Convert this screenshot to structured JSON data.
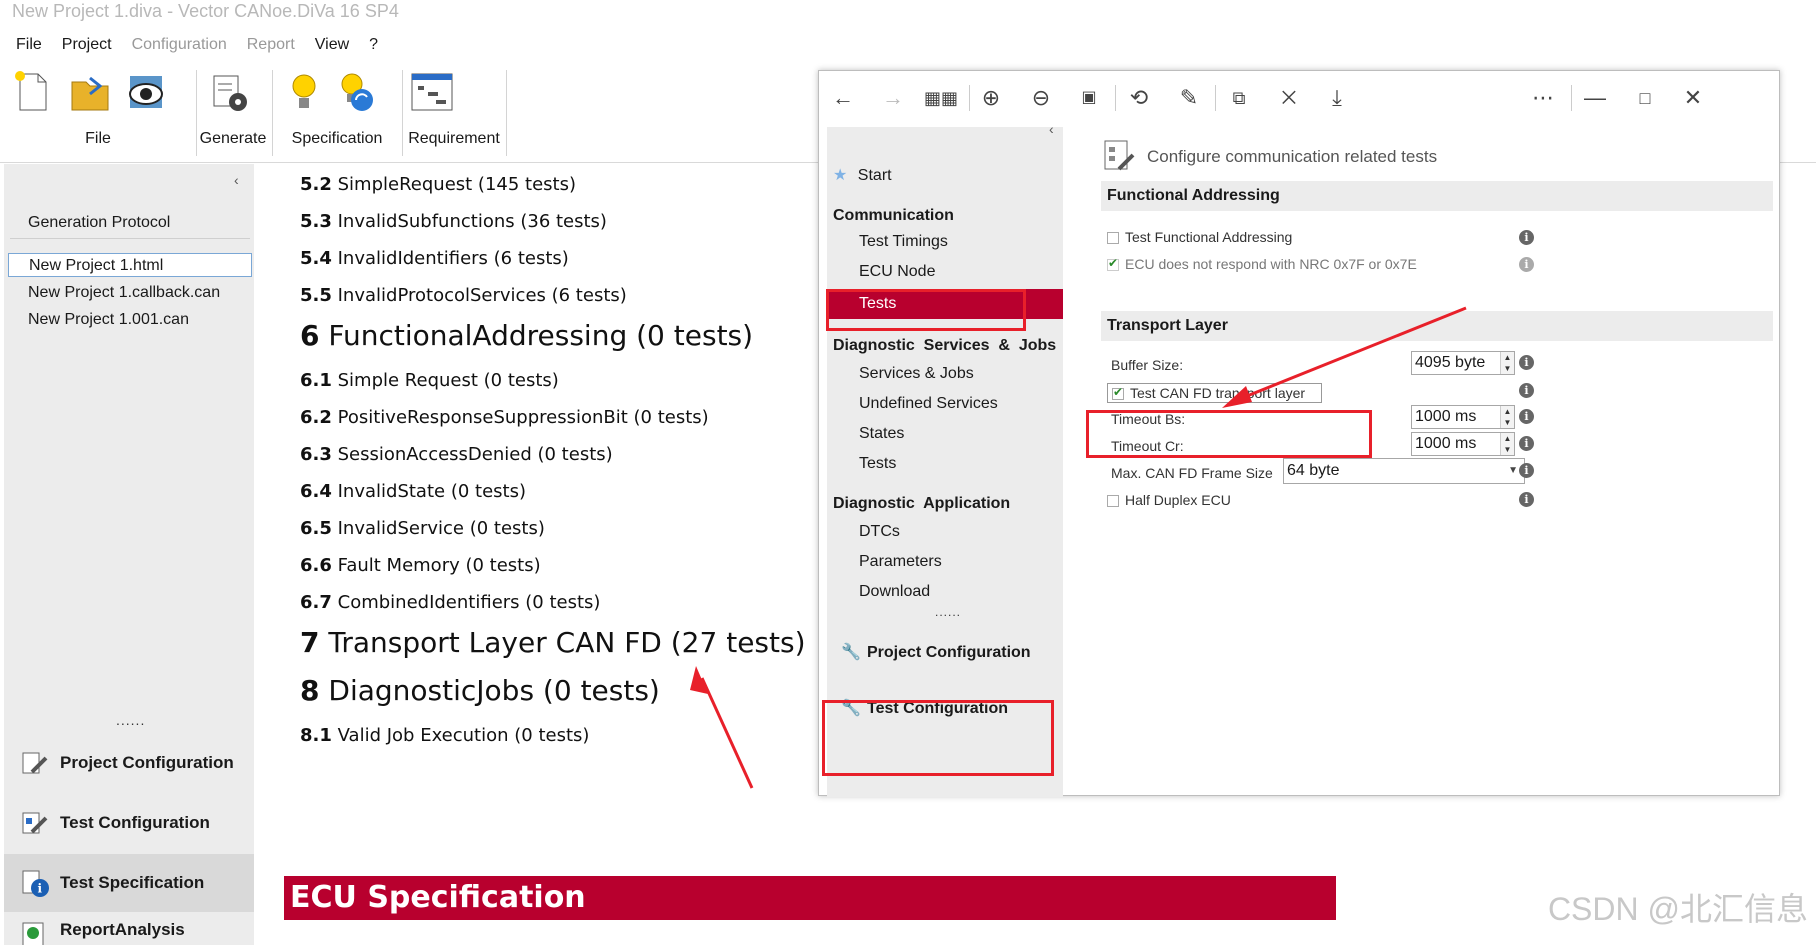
{
  "window_title": "New Project 1.diva - Vector CANoe.DiVa 16 SP4",
  "menu": [
    "File",
    "Project",
    "Configuration",
    "Report",
    "View",
    "?"
  ],
  "ribbon": {
    "file": "File",
    "generate": "Generate",
    "specification": "Specification",
    "requirement": "Requirement"
  },
  "left_panel": {
    "collapse": "‹",
    "heading": "Generation Protocol",
    "files": [
      "New Project 1.html",
      "New Project 1.callback.can",
      "New Project 1.001.can"
    ],
    "more": "......",
    "nav": [
      "Project Configuration",
      "Test Configuration",
      "Test Specification",
      "ReportAnalysis"
    ]
  },
  "tests_list": [
    {
      "num": "5.2",
      "text": "SimpleRequest (145 tests)"
    },
    {
      "num": "5.3",
      "text": "InvalidSubfunctions (36 tests)"
    },
    {
      "num": "5.4",
      "text": "InvalidIdentifiers (6 tests)"
    },
    {
      "num": "5.5",
      "text": "InvalidProtocolServices (6 tests)"
    },
    {
      "num": "6",
      "text": "FunctionalAddressing (0 tests)"
    },
    {
      "num": "6.1",
      "text": "Simple Request (0 tests)"
    },
    {
      "num": "6.2",
      "text": "PositiveResponseSuppressionBit (0 tests)"
    },
    {
      "num": "6.3",
      "text": "SessionAccessDenied (0 tests)"
    },
    {
      "num": "6.4",
      "text": "InvalidState (0 tests)"
    },
    {
      "num": "6.5",
      "text": "InvalidService (0 tests)"
    },
    {
      "num": "6.6",
      "text": "Fault Memory (0 tests)"
    },
    {
      "num": "6.7",
      "text": "CombinedIdentifiers (0 tests)"
    },
    {
      "num": "7",
      "text": "Transport Layer CAN FD (27 tests)"
    },
    {
      "num": "8",
      "text": "DiagnosticJobs (0 tests)"
    },
    {
      "num": "8.1",
      "text": "Valid Job Execution (0 tests)"
    }
  ],
  "ecu_spec": "ECU Specification",
  "dialog": {
    "collapse": "‹",
    "nav": {
      "start": "Start",
      "communication": "Communication",
      "test_timings": "Test Timings",
      "ecu_node": "ECU Node",
      "tests": "Tests",
      "diag_services_jobs": "Diagnostic  Services  &  Jobs",
      "services_jobs": "Services & Jobs",
      "undefined_services": "Undefined Services",
      "states": "States",
      "tests2": "Tests",
      "diag_application": "Diagnostic  Application",
      "dtcs": "DTCs",
      "parameters": "Parameters",
      "download": "Download",
      "more": "......",
      "project_configuration": "Project Configuration",
      "test_configuration": "Test Configuration"
    },
    "header": "Configure communication related tests",
    "functional_addressing": {
      "title": "Functional Addressing",
      "test_functional_addressing": "Test Functional Addressing",
      "no_nrc": "ECU does not respond with NRC 0x7F or 0x7E"
    },
    "transport_layer": {
      "title": "Transport Layer",
      "buffer_size_label": "Buffer Size:",
      "buffer_size": "4095 byte",
      "test_can_fd": "Test CAN FD transport layer",
      "timeout_bs_label": "Timeout Bs:",
      "timeout_bs": "1000 ms",
      "timeout_cr_label": "Timeout Cr:",
      "timeout_cr": "1000 ms",
      "max_frame_label": "Max. CAN FD Frame Size",
      "max_frame": "64 byte",
      "half_duplex": "Half Duplex ECU"
    }
  },
  "watermark": "CSDN @北汇信息",
  "colors": {
    "accent": "#b8002e",
    "highlight": "#e8202a",
    "panel": "#ececec"
  }
}
